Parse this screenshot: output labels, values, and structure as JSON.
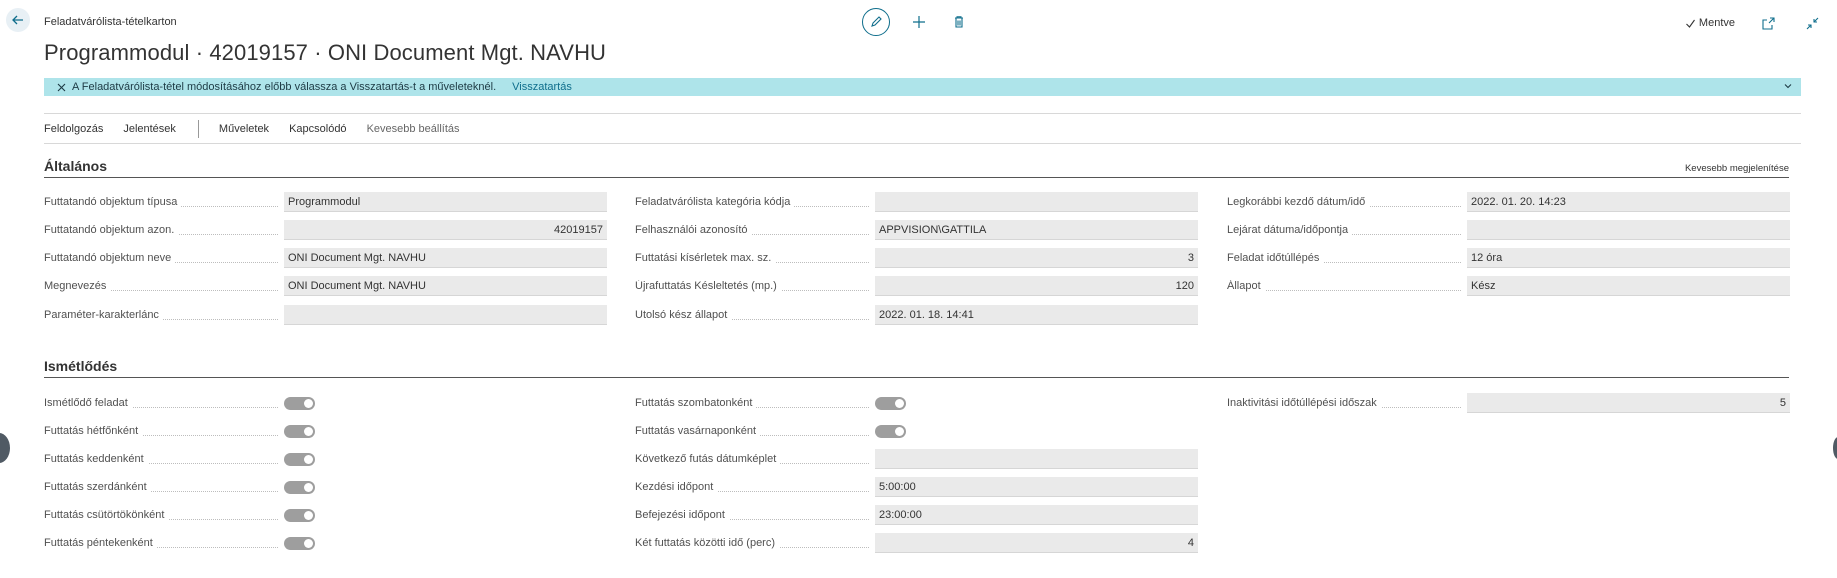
{
  "breadcrumb": "Feladatvárólista-tételkarton",
  "title": "Programmodul · 42019157 · ONI Document Mgt. NAVHU",
  "saved_label": "Mentve",
  "banner": {
    "message": "A Feladatvárólista-tétel módosításához előbb válassza a Visszatartás-t a műveleteknél.",
    "link": "Visszatartás"
  },
  "actions": {
    "process": "Feldolgozás",
    "reports": "Jelentések",
    "actions": "Műveletek",
    "related": "Kapcsolódó",
    "fewer_options": "Kevesebb beállítás"
  },
  "general": {
    "title": "Általános",
    "show_less": "Kevesebb megjelenítése",
    "col1": [
      {
        "label": "Futtatandó objektum típusa",
        "value": "Programmodul",
        "align": "left"
      },
      {
        "label": "Futtatandó objektum azon.",
        "value": "42019157",
        "align": "right"
      },
      {
        "label": "Futtatandó objektum neve",
        "value": "ONI Document Mgt. NAVHU",
        "align": "left"
      },
      {
        "label": "Megnevezés",
        "value": "ONI Document Mgt. NAVHU",
        "align": "left"
      },
      {
        "label": "Paraméter-karakterlánc",
        "value": "",
        "align": "left"
      }
    ],
    "col2": [
      {
        "label": "Feladatvárólista kategória kódja",
        "value": "",
        "align": "left"
      },
      {
        "label": "Felhasználói azonosító",
        "value": "APPVISION\\GATTILA",
        "align": "left"
      },
      {
        "label": "Futtatási kísérletek max. sz.",
        "value": "3",
        "align": "right"
      },
      {
        "label": "Újrafuttatás Késleltetés (mp.)",
        "value": "120",
        "align": "right"
      },
      {
        "label": "Utolsó kész állapot",
        "value": "2022. 01. 18. 14:41",
        "align": "left"
      }
    ],
    "col3": [
      {
        "label": "Legkorábbi kezdő dátum/idő",
        "value": "2022. 01. 20. 14:23",
        "align": "left"
      },
      {
        "label": "Lejárat dátuma/időpontja",
        "value": "",
        "align": "left"
      },
      {
        "label": "Feladat időtúllépés",
        "value": "12 óra",
        "align": "left"
      },
      {
        "label": "Állapot",
        "value": "Kész",
        "align": "left"
      }
    ]
  },
  "recurrence": {
    "title": "Ismétlődés",
    "col1": [
      {
        "label": "Ismétlődő feladat",
        "on": true
      },
      {
        "label": "Futtatás hétfőnként",
        "on": true
      },
      {
        "label": "Futtatás keddenként",
        "on": true
      },
      {
        "label": "Futtatás szerdánként",
        "on": true
      },
      {
        "label": "Futtatás csütörtökönként",
        "on": true
      },
      {
        "label": "Futtatás péntekenként",
        "on": true
      }
    ],
    "col2_toggles": [
      {
        "label": "Futtatás szombatonként",
        "on": true
      },
      {
        "label": "Futtatás vasárnaponként",
        "on": true
      }
    ],
    "col2_fields": [
      {
        "label": "Következő futás dátumképlet",
        "value": "",
        "align": "left"
      },
      {
        "label": "Kezdési időpont",
        "value": "5:00:00",
        "align": "left"
      },
      {
        "label": "Befejezési időpont",
        "value": "23:00:00",
        "align": "left"
      },
      {
        "label": "Két futtatás közötti idő (perc)",
        "value": "4",
        "align": "right"
      }
    ],
    "col3": [
      {
        "label": "Inaktivitási időtúllépési időszak",
        "value": "5",
        "align": "right"
      }
    ]
  },
  "colors": {
    "accent": "#0f6e8c",
    "banner_bg": "#aee4ea",
    "field_bg": "#eaeaea"
  }
}
